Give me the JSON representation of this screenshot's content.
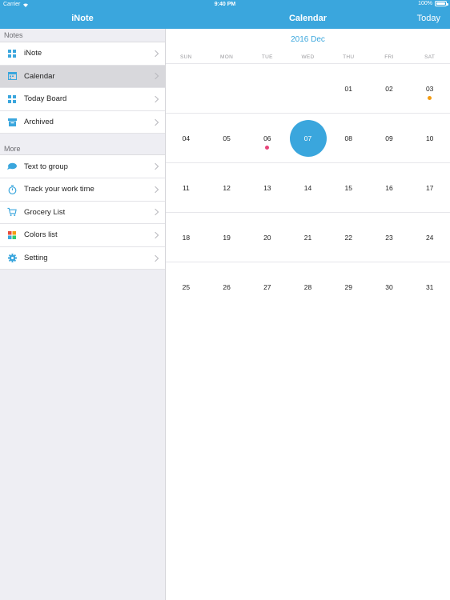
{
  "status": {
    "carrier": "Carrier",
    "time": "9:40 PM",
    "battery": "100%",
    "battery_level": 1.0
  },
  "nav": {
    "left_title": "iNote",
    "main_title": "Calendar",
    "today_button": "Today"
  },
  "sidebar": {
    "notes_header": "Notes",
    "notes_items": [
      {
        "label": "iNote",
        "icon": "grid-icon",
        "selected": false
      },
      {
        "label": "Calendar",
        "icon": "calendar-icon",
        "selected": true
      },
      {
        "label": "Today Board",
        "icon": "grid-icon",
        "selected": false
      },
      {
        "label": "Archived",
        "icon": "archive-icon",
        "selected": false
      }
    ],
    "more_header": "More",
    "more_items": [
      {
        "label": "Text to group",
        "icon": "chat-bubble-icon"
      },
      {
        "label": "Track your work time",
        "icon": "stopwatch-icon"
      },
      {
        "label": "Grocery List",
        "icon": "cart-icon"
      },
      {
        "label": "Colors list",
        "icon": "color-squares-icon"
      },
      {
        "label": "Setting",
        "icon": "gear-icon"
      }
    ]
  },
  "calendar": {
    "month_label": "2016 Dec",
    "weekdays": [
      "SUN",
      "MON",
      "TUE",
      "WED",
      "THU",
      "FRI",
      "SAT"
    ],
    "weeks": [
      [
        "",
        "",
        "",
        "",
        "01",
        "02",
        "03"
      ],
      [
        "04",
        "05",
        "06",
        "07",
        "08",
        "09",
        "10"
      ],
      [
        "11",
        "12",
        "13",
        "14",
        "15",
        "16",
        "17"
      ],
      [
        "18",
        "19",
        "20",
        "21",
        "22",
        "23",
        "24"
      ],
      [
        "25",
        "26",
        "27",
        "28",
        "29",
        "30",
        "31"
      ]
    ],
    "selected_day": "07",
    "event_dots": [
      {
        "day": "03",
        "color": "#f39c12"
      },
      {
        "day": "06",
        "color": "#e8457a"
      }
    ]
  },
  "colors": {
    "accent": "#3aa6dd",
    "sidebar_bg": "#eeeef3",
    "selected_row": "#d8d8dc"
  }
}
